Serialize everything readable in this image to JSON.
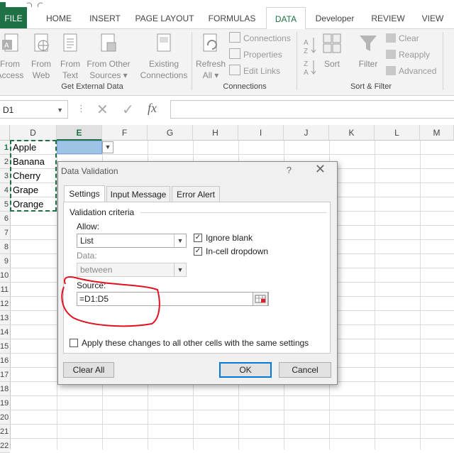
{
  "ribbon_tabs": [
    {
      "label": "FILE"
    },
    {
      "label": "HOME"
    },
    {
      "label": "INSERT"
    },
    {
      "label": "PAGE LAYOUT"
    },
    {
      "label": "FORMULAS"
    },
    {
      "label": "DATA"
    },
    {
      "label": "Developer"
    },
    {
      "label": "REVIEW"
    },
    {
      "label": "VIEW"
    }
  ],
  "active_tab": "DATA",
  "ribbon": {
    "get_external_data": {
      "label": "Get External Data",
      "buttons": [
        {
          "line1": "From",
          "line2": "Access"
        },
        {
          "line1": "From",
          "line2": "Web"
        },
        {
          "line1": "From",
          "line2": "Text"
        },
        {
          "line1": "From Other",
          "line2": "Sources ▾"
        },
        {
          "line1": "Existing",
          "line2": "Connections"
        }
      ]
    },
    "connections": {
      "label": "Connections",
      "refresh": {
        "line1": "Refresh",
        "line2": "All ▾"
      },
      "items": [
        "Connections",
        "Properties",
        "Edit Links"
      ]
    },
    "sort_filter": {
      "label": "Sort & Filter",
      "sort": "Sort",
      "filter": "Filter",
      "items": [
        "Clear",
        "Reapply",
        "Advanced"
      ]
    }
  },
  "formula_bar": {
    "name_box": "D1",
    "cancel_glyph": "✕",
    "enter_glyph": "✓",
    "fx": "fx",
    "formula": ""
  },
  "sheet": {
    "columns": [
      "D",
      "E",
      "F",
      "G",
      "H",
      "I",
      "J",
      "K",
      "L",
      "M"
    ],
    "selected_column": "E",
    "rows": [
      "1",
      "2",
      "3",
      "4",
      "5",
      "6",
      "7",
      "8",
      "9",
      "10",
      "11",
      "12",
      "13",
      "14",
      "15",
      "16",
      "17",
      "18",
      "19",
      "20",
      "21",
      "22"
    ],
    "cells_d": [
      "Apple",
      "Banana",
      "Cherry",
      "Grape",
      "Orange"
    ]
  },
  "dialog": {
    "title": "Data Validation",
    "help": "?",
    "close": "✕",
    "tabs": [
      "Settings",
      "Input Message",
      "Error Alert"
    ],
    "active_tab": "Settings",
    "section": "Validation criteria",
    "allow_label": "Allow:",
    "allow_value": "List",
    "data_label": "Data:",
    "data_value": "between",
    "ignore_blank": {
      "label": "Ignore blank",
      "checked": true
    },
    "in_cell_dropdown": {
      "label": "In-cell dropdown",
      "checked": true
    },
    "source_label": "Source:",
    "source_value": "=D1:D5",
    "apply_all": {
      "label": "Apply these changes to all other cells with the same settings",
      "checked": false
    },
    "buttons": {
      "clear_all": "Clear All",
      "ok": "OK",
      "cancel": "Cancel"
    }
  },
  "colors": {
    "excel_green": "#1e7145",
    "annotation_red": "#e0101e",
    "selection_fill": "#9dc3e6",
    "default_button_border": "#0078d7"
  }
}
